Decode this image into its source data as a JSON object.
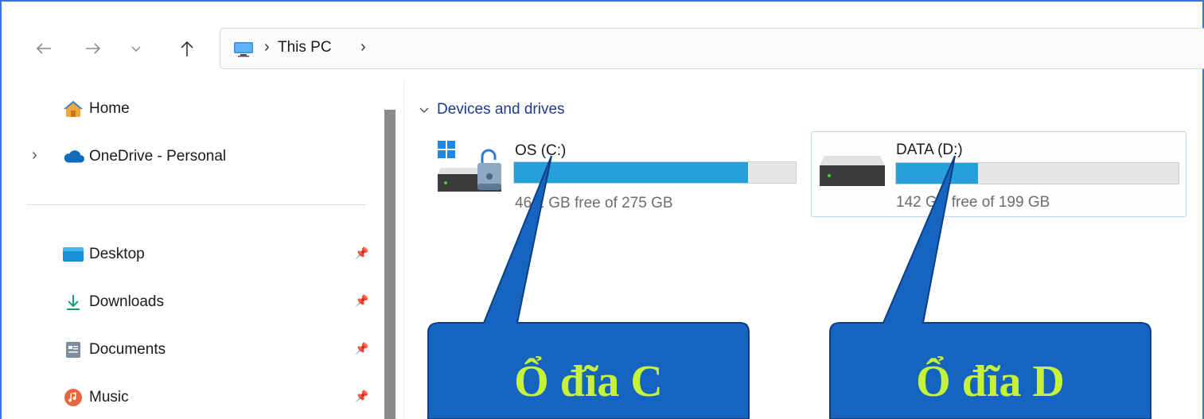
{
  "toolbar": {
    "back_icon": "arrow-left-icon",
    "forward_icon": "arrow-right-icon",
    "recent_icon": "chevron-down-icon",
    "up_icon": "arrow-up-icon"
  },
  "address_bar": {
    "icon": "monitor-icon",
    "crumbs": [
      "This PC"
    ],
    "separator": "›"
  },
  "nav_pane": {
    "items": [
      {
        "label": "Home",
        "icon": "home-icon"
      },
      {
        "label": "OneDrive - Personal",
        "icon": "cloud-icon",
        "expand": "›"
      },
      {
        "label": "Desktop",
        "icon": "desktop-folder-icon",
        "pinned": true
      },
      {
        "label": "Downloads",
        "icon": "download-icon",
        "pinned": true
      },
      {
        "label": "Documents",
        "icon": "documents-icon",
        "pinned": true
      },
      {
        "label": "Music",
        "icon": "music-icon",
        "pinned": true
      }
    ]
  },
  "content": {
    "group_label": "Devices and drives",
    "drives": [
      {
        "name": "OS (C:)",
        "free_text": "46.1 GB free of 275 GB",
        "used_fraction": 0.83,
        "icon": "system-drive-locked-icon"
      },
      {
        "name": "DATA (D:)",
        "free_text": "142 GB free of 199 GB",
        "used_fraction": 0.29,
        "icon": "hard-drive-icon"
      }
    ]
  },
  "callouts": [
    {
      "text": "Ổ đĩa C"
    },
    {
      "text": "Ổ đĩa D"
    }
  ],
  "colors": {
    "accent": "#26a0da",
    "callout_fill": "#1565c0",
    "callout_text": "#c6f23a",
    "group_header": "#1f3a8a"
  }
}
